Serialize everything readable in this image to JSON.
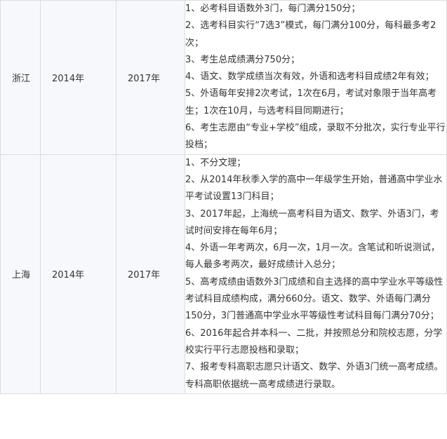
{
  "rows": [
    {
      "province": "浙江",
      "start_year": "2014年",
      "implement_year": "2017年",
      "items": [
        "1、必考科目语数外3门，每门满分150分；",
        "2、选考科目实行“7选3”模式，每门满分100分，每科最多考2次；",
        "3、考生总成绩满分750分；",
        "4、语文、数学成绩当次有效，外语和选考科目成绩2年有效；",
        "5、外语每年安排2次考试，1次在6月，考试对象限于当年高考生；1次在10月，与选考科目同期进行；",
        "6、考生志愿由“专业+学校”组成，录取不分批次，实行专业平行投档；"
      ]
    },
    {
      "province": "上海",
      "start_year": "2014年",
      "implement_year": "2017年",
      "items": [
        "1、不分文理；",
        "2、从2014年秋季入学的高中一年级学生开始，普通高中学业水平考试设置13门科目；",
        "3、2017年起，上海统一高考科目为语文、数学、外语3门，考试时间安排在每年6月；",
        "4、外语一年考两次，6月一次，1月一次。含笔试和听说测试，每人最多考两次，最好成绩计入总分；",
        "5、高考成绩由语数外3门成绩和自主选择的高中学业水平等级性考试科目成绩构成，满分660分。语文、数学、外语每门满分150分，3门普通高中学业水平等级性考试科目每门满分70分；",
        "6、2016年起合并本科一、二批，并按照总分和院校志愿，分学校实行平行志愿投档和录取；",
        "7、报考专科高职志愿只计语文、数学、外语3门统一高考成绩。专科高职依据统一高考成绩进行录取。"
      ]
    }
  ]
}
